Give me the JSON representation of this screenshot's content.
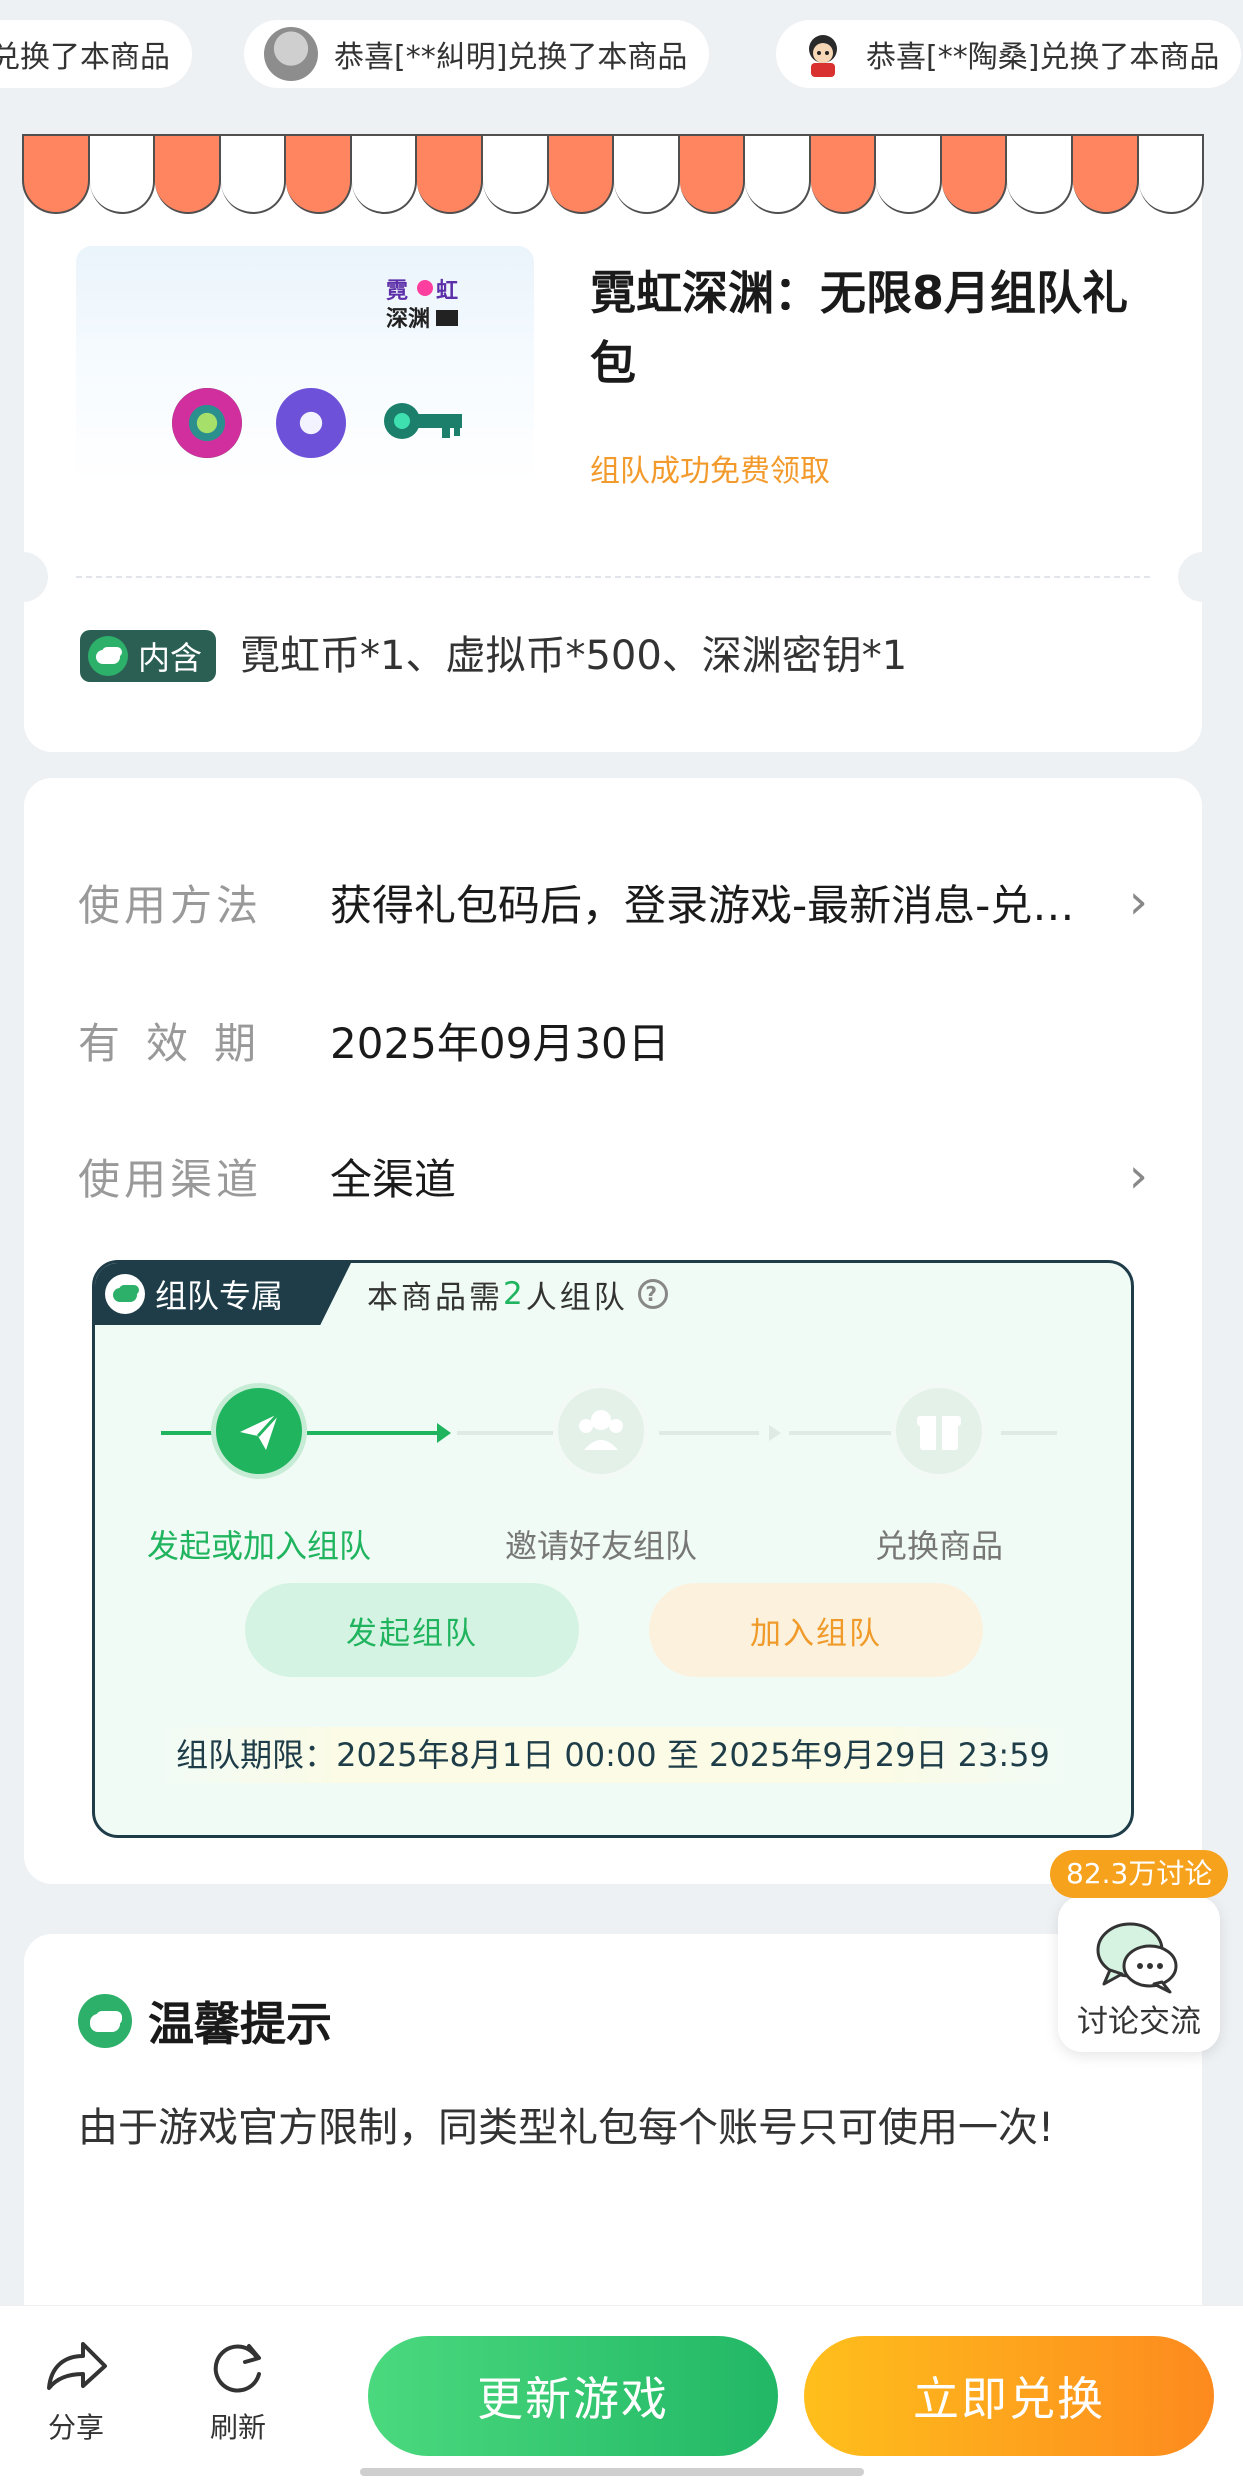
{
  "ticker": [
    {
      "text": "兑换了本商品"
    },
    {
      "text": "恭喜[**糾明]兑换了本商品"
    },
    {
      "text": "恭喜[**陶桑]兑换了本商品"
    }
  ],
  "product": {
    "title": "霓虹深渊：无限8月组队礼包",
    "subtitle": "组队成功免费领取",
    "contain_label": "内含",
    "contain_text": "霓虹币*1、虚拟币*500、深渊密钥*1",
    "logo_text": "霓虹深渊"
  },
  "info": {
    "usage_label": "使用方法",
    "usage_value": "获得礼包码后，登录游戏-最新消息-兑换码",
    "validity_label": "有效期",
    "validity_value": "2025年09月30日",
    "channel_label": "使用渠道",
    "channel_value": "全渠道"
  },
  "team": {
    "tag": "组队专属",
    "need_prefix": "本商品需",
    "need_count": "2",
    "need_suffix": "人组队",
    "steps": [
      "发起或加入组队",
      "邀请好友组队",
      "兑换商品"
    ],
    "start_button": "发起组队",
    "join_button": "加入组队",
    "period": "组队期限：2025年8月1日 00:00 至 2025年9月29日 23:59"
  },
  "discussion": {
    "count": "82.3万讨论",
    "label": "讨论交流"
  },
  "tips": {
    "title": "温馨提示",
    "text": "由于游戏官方限制，同类型礼包每个账号只可使用一次!"
  },
  "bottom": {
    "share": "分享",
    "refresh": "刷新",
    "update_button": "更新游戏",
    "redeem_button": "立即兑换"
  },
  "colors": {
    "green": "#20b45f",
    "orange": "#f39a2d",
    "dark_teal": "#1e3d48",
    "awning_red": "#ff8561"
  }
}
